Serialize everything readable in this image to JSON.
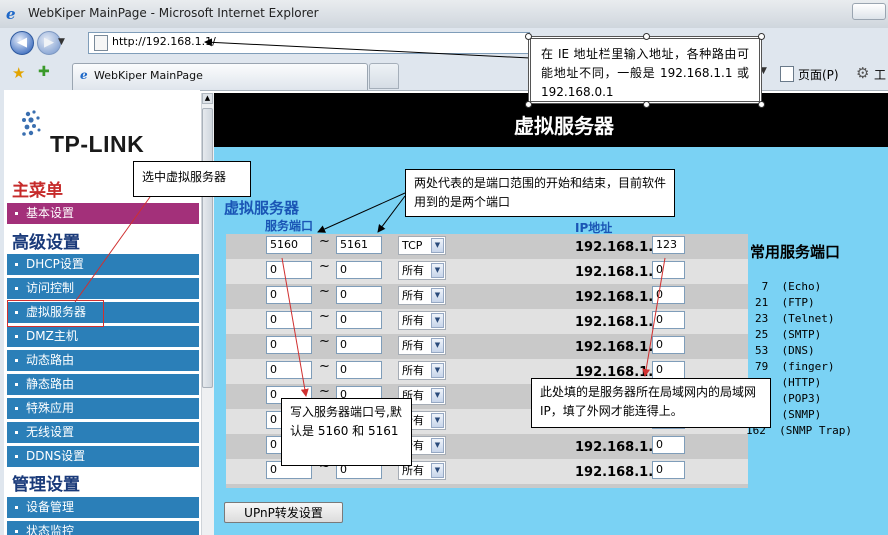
{
  "window": {
    "title": "WebKiper MainPage - Microsoft Internet Explorer"
  },
  "browser": {
    "address": "http://192.168.1.1/",
    "tab_label": "WebKiper MainPage",
    "page_menu": "页面(P)",
    "tools_menu": "工"
  },
  "sidebar": {
    "logo": "TP-LINK",
    "main_menu": "主菜单",
    "basic_settings": "基本设置",
    "advanced_heading": "高级设置",
    "advanced_items": [
      "DHCP设置",
      "访问控制",
      "虚拟服务器",
      "DMZ主机",
      "动态路由",
      "静态路由",
      "特殊应用",
      "无线设置",
      "DDNS设置"
    ],
    "management_heading": "管理设置",
    "management_items": [
      "设备管理",
      "状态监控"
    ]
  },
  "main": {
    "banner_title": "虚拟服务器",
    "subtitle": "虚拟服务器",
    "col_port": "服务端口",
    "col_ip": "IP地址",
    "ip_prefix": "192.168.1.",
    "tilde": "~",
    "rows": [
      {
        "start": "5160",
        "end": "5161",
        "protocol": "TCP",
        "ip": "123"
      },
      {
        "start": "0",
        "end": "0",
        "protocol": "所有",
        "ip": "0"
      },
      {
        "start": "0",
        "end": "0",
        "protocol": "所有",
        "ip": "0"
      },
      {
        "start": "0",
        "end": "0",
        "protocol": "所有",
        "ip": "0"
      },
      {
        "start": "0",
        "end": "0",
        "protocol": "所有",
        "ip": "0"
      },
      {
        "start": "0",
        "end": "0",
        "protocol": "所有",
        "ip": "0"
      },
      {
        "start": "0",
        "end": "0",
        "protocol": "所有",
        "ip": "0"
      },
      {
        "start": "0",
        "end": "0",
        "protocol": "所有",
        "ip": "0"
      },
      {
        "start": "0",
        "end": "0",
        "protocol": "所有",
        "ip": "0"
      },
      {
        "start": "0",
        "end": "0",
        "protocol": "所有",
        "ip": "0"
      }
    ],
    "common_ports_title": "常用服务端口",
    "common_ports": [
      " 7  (Echo)",
      "21  (FTP)",
      "23  (Telnet)",
      "25  (SMTP)",
      "53  (DNS)",
      "79  (finger)",
      "    (HTTP)",
      "    (POP3)",
      "    (SNMP)",
      "162  (SNMP Trap)"
    ],
    "upnp_button": "UPnP转发设置"
  },
  "callouts": {
    "ie_address": "在 IE 地址栏里输入地址，各种路由可能地址不同，一般是 192.168.1.1 或 192.168.0.1",
    "select_vs": "选中虚拟服务器",
    "port_range": "两处代表的是端口范围的开始和结束，目前软件用到的是两个端口",
    "write_port": "写入服务器端口号,默认是 5160 和 5161",
    "lan_ip": "此处填的是服务器所在局域网内的局域网 IP，填了外网才能连得上。"
  },
  "colors": {
    "sidebar_item": "#2b7fb8",
    "sidebar_active": "#a3307a",
    "content_bg": "#7ad2f4",
    "heading_blue": "#1a55b5",
    "main_menu_red": "#c62a2a",
    "arrow_red": "#d03030"
  }
}
